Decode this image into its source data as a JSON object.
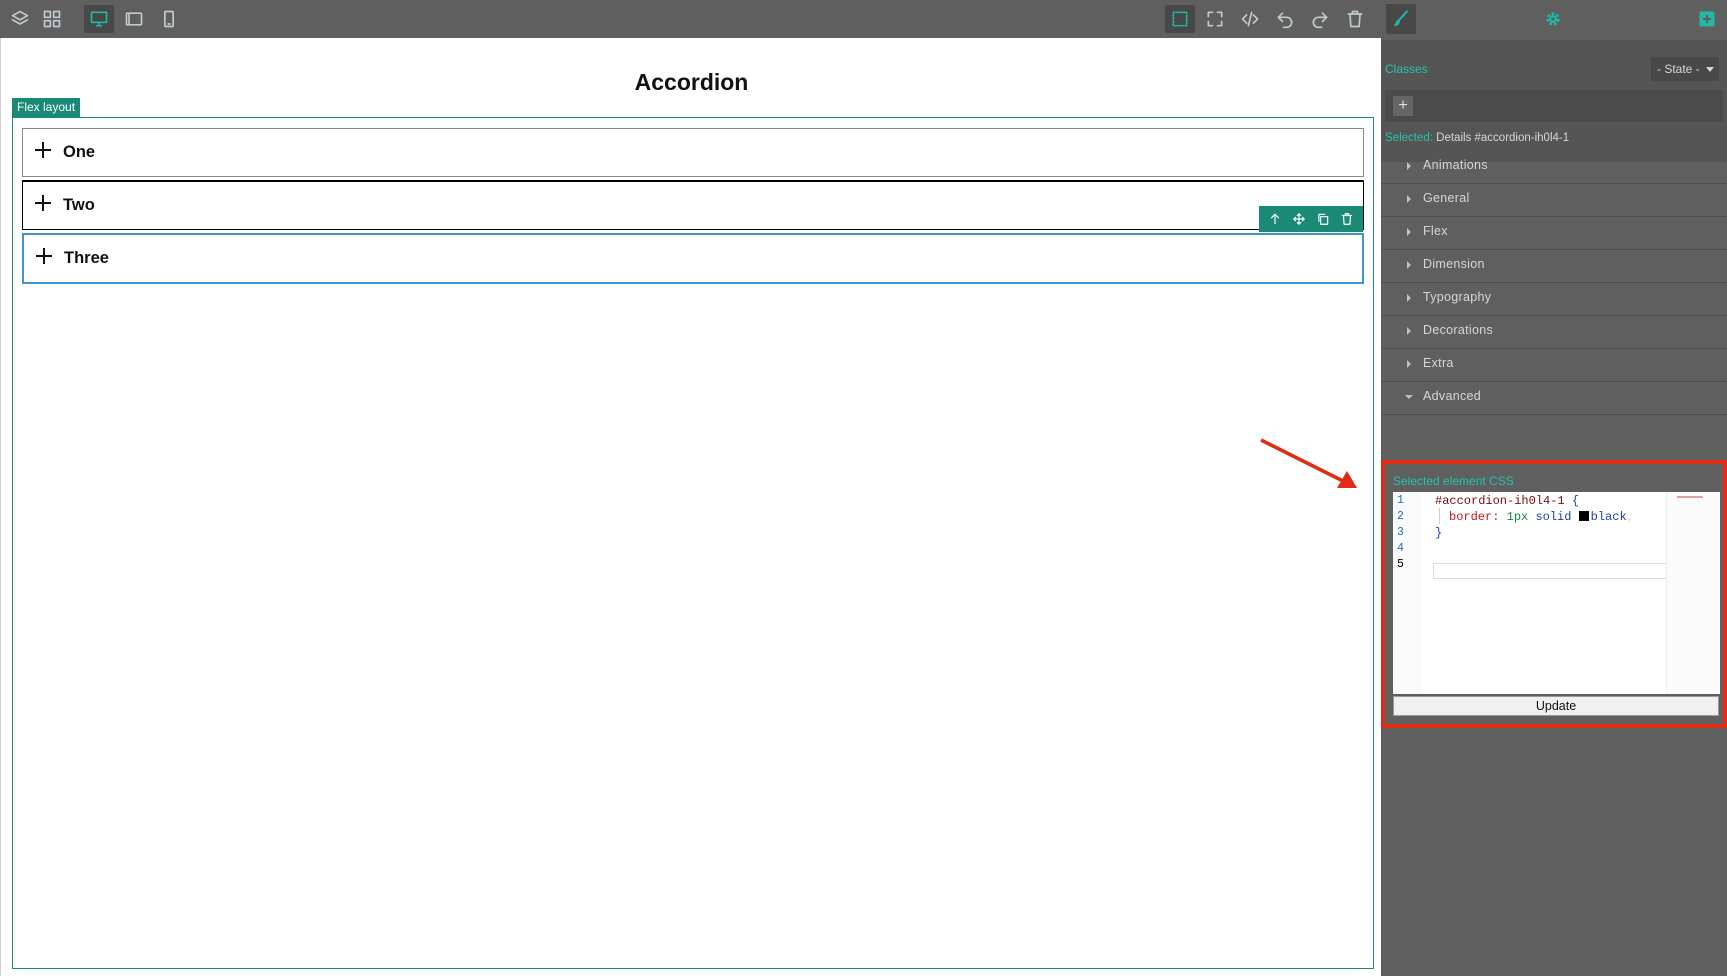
{
  "canvas": {
    "page_title": "Accordion",
    "flex_badge": "Flex layout",
    "accordion_items": [
      {
        "label": "One"
      },
      {
        "label": "Two"
      },
      {
        "label": "Three"
      }
    ]
  },
  "panel": {
    "classes_label": "Classes",
    "state_select": "- State -",
    "add_class_symbol": "+",
    "selected_prefix": "Selected:",
    "selected_value": "Details #accordion-ih0l4-1",
    "sectors": [
      {
        "label": "Animations",
        "open": false
      },
      {
        "label": "General",
        "open": false
      },
      {
        "label": "Flex",
        "open": false
      },
      {
        "label": "Dimension",
        "open": false
      },
      {
        "label": "Typography",
        "open": false
      },
      {
        "label": "Decorations",
        "open": false
      },
      {
        "label": "Extra",
        "open": false
      },
      {
        "label": "Advanced",
        "open": true
      }
    ],
    "css_title": "Selected element CSS",
    "line_numbers": [
      "1",
      "2",
      "3",
      "4",
      "5"
    ],
    "code": {
      "selector": "#accordion-ih0l4-1",
      "open_brace": "{",
      "property": "border:",
      "value_num": "1px",
      "value_style": "solid",
      "value_color": "black",
      "semicolon": ";",
      "close_brace": "}"
    },
    "update_label": "Update"
  },
  "colors": {
    "accent": "#1fb9a6",
    "badge": "#1a8a76",
    "highlight_box": "#e12a14",
    "selected_outline": "#3b97d3"
  }
}
